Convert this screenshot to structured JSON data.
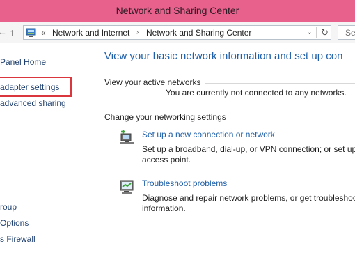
{
  "window": {
    "title": "Network and Sharing Center",
    "title_bar_color": "#e8618c"
  },
  "navigation": {
    "back_icon": "back-arrow-icon",
    "up_icon": "up-arrow-icon",
    "overflow_glyph": "«",
    "breadcrumbs": [
      "Network and Internet",
      "Network and Sharing Center"
    ],
    "separator_glyph": "›",
    "dropdown_glyph": "⌄",
    "refresh_glyph": "↻",
    "search_placeholder": "Se"
  },
  "sidebar": {
    "items": [
      {
        "label": "Panel Home"
      },
      {
        "label": "adapter settings",
        "highlighted": true
      },
      {
        "label": "advanced sharing"
      },
      {
        "label": "roup"
      },
      {
        "label": "Options"
      },
      {
        "label": "s Firewall"
      }
    ],
    "highlight_color": "#d9363e"
  },
  "main": {
    "heading": "View your basic network information and set up con",
    "active_networks": {
      "label": "View your active networks",
      "status": "You are currently not connected to any networks."
    },
    "change_settings": {
      "label": "Change your networking settings",
      "tasks": [
        {
          "link": "Set up a new connection or network",
          "description_line1": "Set up a broadband, dial-up, or VPN connection; or set up",
          "description_line2": "access point.",
          "icon": "new-connection-icon"
        },
        {
          "link": "Troubleshoot problems",
          "description_line1": "Diagnose and repair network problems, or get troubleshoo",
          "description_line2": "information.",
          "icon": "troubleshoot-icon"
        }
      ]
    }
  }
}
